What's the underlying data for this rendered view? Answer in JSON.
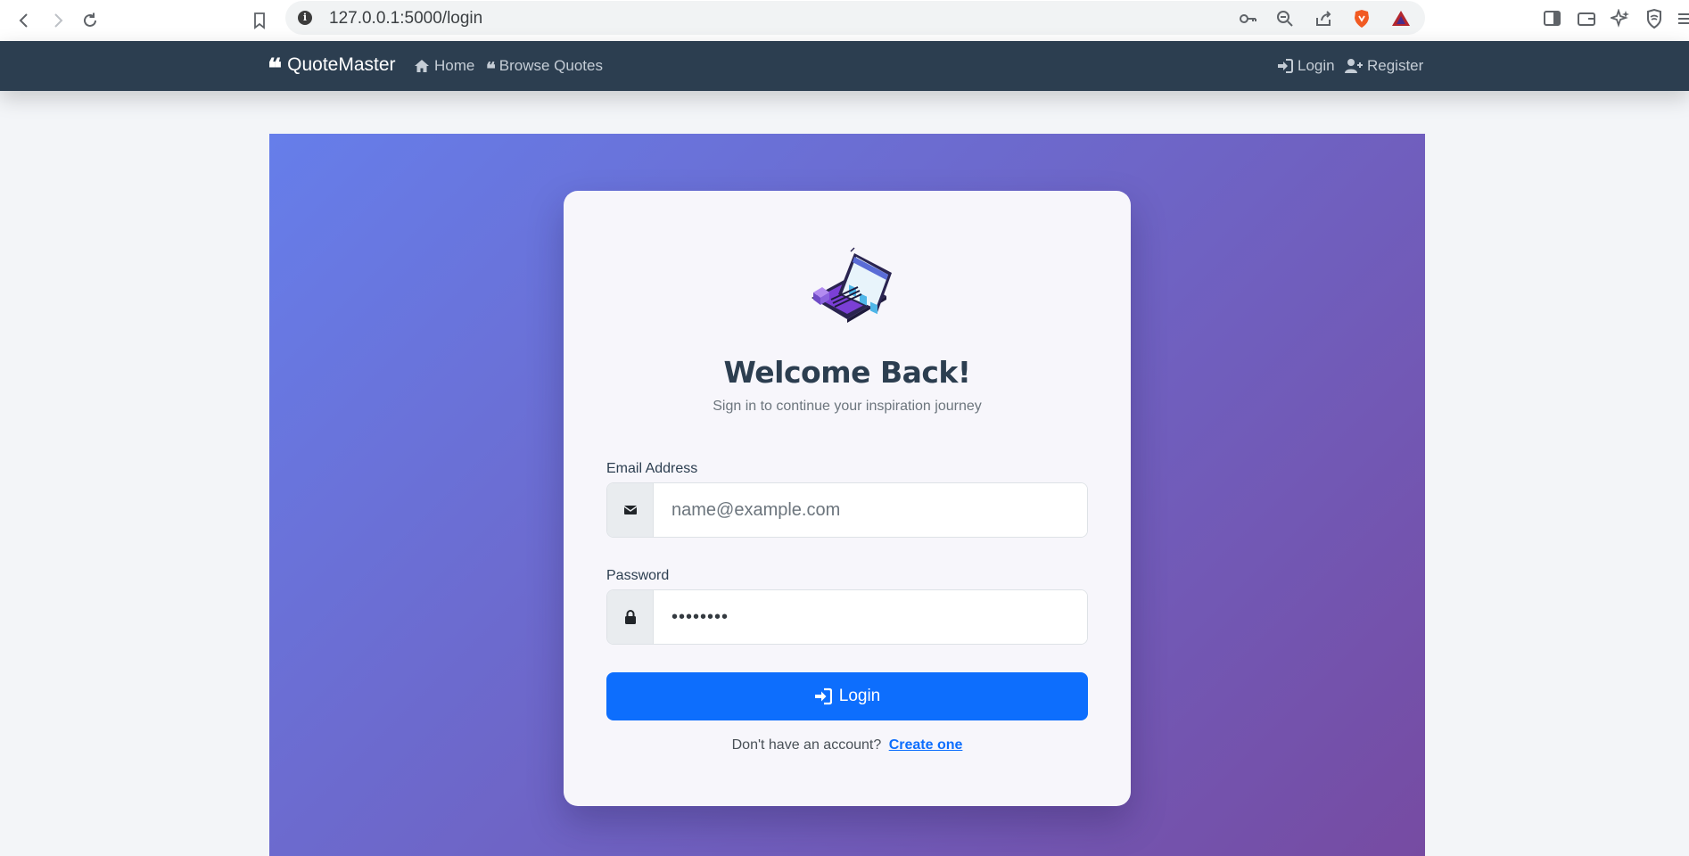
{
  "browser": {
    "url": "127.0.0.1:5000/login",
    "info_icon": "i",
    "icons": [
      "back-icon",
      "forward-icon",
      "reload-icon",
      "bookmark-icon",
      "key-icon",
      "zoom-out-icon",
      "share-icon",
      "brave-shield-icon",
      "brave-rewards-icon",
      "sidebar-icon",
      "wallet-icon",
      "leo-ai-icon",
      "vpn-shield-icon",
      "menu-icon"
    ]
  },
  "navbar": {
    "brand_glyph": "❝",
    "brand": "QuoteMaster",
    "home": "Home",
    "browse_glyph": "❝",
    "browse": "Browse Quotes",
    "login": "Login",
    "register": "Register"
  },
  "card": {
    "title": "Welcome Back!",
    "subtitle": "Sign in to continue your inspiration journey",
    "email_label": "Email Address",
    "email_placeholder": "name@example.com",
    "password_label": "Password",
    "password_value": "••••••••",
    "login_button": "Login",
    "signup_prompt": "Don't have an account?",
    "signup_link": "Create one"
  },
  "colors": {
    "navbar": "#2c3e50",
    "gradient_start": "#667eea",
    "gradient_end": "#764ba2",
    "primary": "#0d6efd"
  }
}
